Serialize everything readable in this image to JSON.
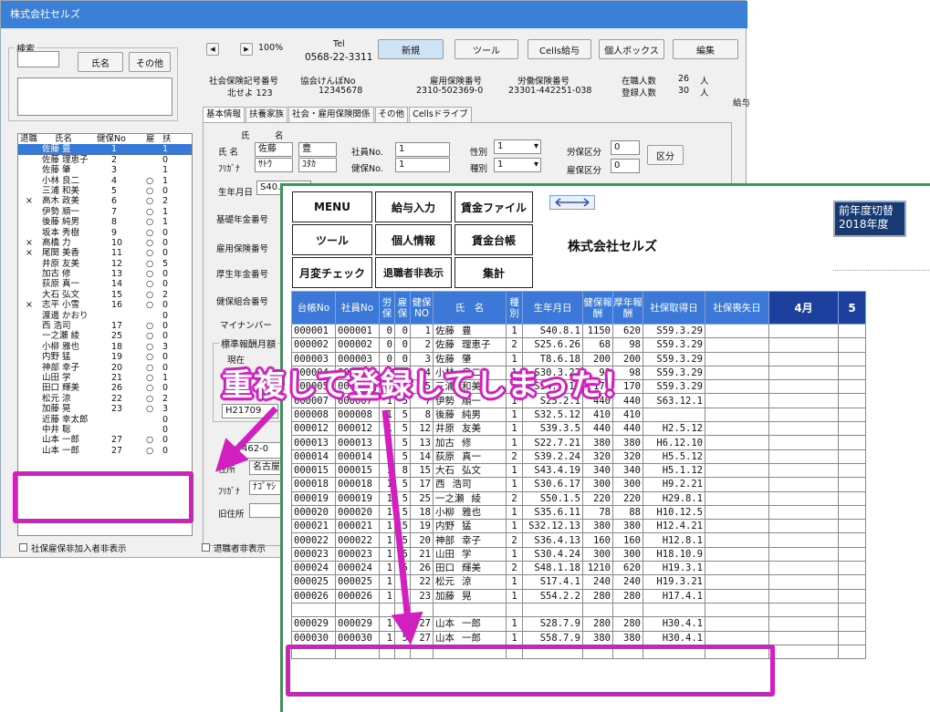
{
  "window": {
    "title": "株式会社セルズ"
  },
  "search": {
    "legend": "検索",
    "name_btn": "氏名",
    "other_btn": "その他"
  },
  "list_header": {
    "mark": "退職",
    "name": "氏名",
    "no": "健保No",
    "ken": "雇",
    "fu": "扶"
  },
  "employees": [
    {
      "mark": "",
      "name": "佐藤 豊",
      "no": "1",
      "ken": "",
      "fu": "1",
      "selected": true
    },
    {
      "mark": "",
      "name": "佐藤 理恵子",
      "no": "2",
      "ken": "",
      "fu": "0"
    },
    {
      "mark": "",
      "name": "佐藤 肇",
      "no": "3",
      "ken": "",
      "fu": "1"
    },
    {
      "mark": "",
      "name": "小林 良二",
      "no": "4",
      "ken": "○",
      "fu": "1"
    },
    {
      "mark": "",
      "name": "三浦 和美",
      "no": "5",
      "ken": "○",
      "fu": "0"
    },
    {
      "mark": "×",
      "name": "高木 政美",
      "no": "6",
      "ken": "○",
      "fu": "2"
    },
    {
      "mark": "",
      "name": "伊勢 順一",
      "no": "7",
      "ken": "○",
      "fu": "1"
    },
    {
      "mark": "",
      "name": "後藤 純男",
      "no": "8",
      "ken": "○",
      "fu": "1"
    },
    {
      "mark": "",
      "name": "坂本 秀樹",
      "no": "9",
      "ken": "○",
      "fu": "0"
    },
    {
      "mark": "×",
      "name": "高橋 力",
      "no": "10",
      "ken": "○",
      "fu": "0"
    },
    {
      "mark": "×",
      "name": "尾関 美香",
      "no": "11",
      "ken": "○",
      "fu": "0"
    },
    {
      "mark": "",
      "name": "井原 友美",
      "no": "12",
      "ken": "○",
      "fu": "5"
    },
    {
      "mark": "",
      "name": "加古 修",
      "no": "13",
      "ken": "○",
      "fu": "0"
    },
    {
      "mark": "",
      "name": "荻原 真一",
      "no": "14",
      "ken": "○",
      "fu": "0"
    },
    {
      "mark": "",
      "name": "大石 弘文",
      "no": "15",
      "ken": "○",
      "fu": "2"
    },
    {
      "mark": "×",
      "name": "志平 小雪",
      "no": "16",
      "ken": "○",
      "fu": "0"
    },
    {
      "mark": "",
      "name": "渡邊 かおり",
      "no": "",
      "ken": "",
      "fu": "0"
    },
    {
      "mark": "",
      "name": "西 浩司",
      "no": "17",
      "ken": "○",
      "fu": "0"
    },
    {
      "mark": "",
      "name": "一之瀬 綾",
      "no": "25",
      "ken": "○",
      "fu": "0"
    },
    {
      "mark": "",
      "name": "小柳 雅也",
      "no": "18",
      "ken": "○",
      "fu": "3"
    },
    {
      "mark": "",
      "name": "内野 猛",
      "no": "19",
      "ken": "○",
      "fu": "0"
    },
    {
      "mark": "",
      "name": "神部 幸子",
      "no": "20",
      "ken": "○",
      "fu": "0"
    },
    {
      "mark": "",
      "name": "山田 学",
      "no": "21",
      "ken": "○",
      "fu": "1"
    },
    {
      "mark": "",
      "name": "田口 輝美",
      "no": "26",
      "ken": "○",
      "fu": "0"
    },
    {
      "mark": "",
      "name": "松元 涼",
      "no": "22",
      "ken": "○",
      "fu": "2"
    },
    {
      "mark": "",
      "name": "加藤 晃",
      "no": "23",
      "ken": "○",
      "fu": "3"
    },
    {
      "mark": "",
      "name": "近藤 幸太郎",
      "no": "",
      "ken": "",
      "fu": "0"
    },
    {
      "mark": "",
      "name": "中井 聡",
      "no": "",
      "ken": "",
      "fu": "0"
    },
    {
      "mark": "",
      "name": "山本 一郎",
      "no": "27",
      "ken": "○",
      "fu": "0"
    },
    {
      "mark": "",
      "name": "山本 一郎",
      "no": "27",
      "ken": "○",
      "fu": "0"
    }
  ],
  "nav": {
    "first": "◀",
    "next": "▶",
    "zoom": "100%"
  },
  "tel": {
    "label": "Tel",
    "value": "0568-22-3311"
  },
  "toolbar": {
    "new": "新規",
    "tool": "ツール",
    "cells": "Cells給与",
    "personal": "個人ボックス",
    "edit": "編集"
  },
  "insurance": {
    "shaho_label": "社会保険記号番号",
    "shaho_value": "北せよ 123",
    "kyokai_label": "協会けんぽNo",
    "kyokai_value": "12345678",
    "koyo_label": "雇用保険番号",
    "koyo_value": "2310-502369-0",
    "rodo_label": "労働保険番号",
    "rodo_value": "23301-442251-038",
    "zaishoku_label": "在職人数",
    "zaishoku_value": "26",
    "toroku_label": "登録人数",
    "toroku_value": "30",
    "unit": "人",
    "kyu_label": "給与"
  },
  "tabs": [
    "基本情報",
    "扶養家族",
    "社会・雇用保険関係",
    "その他",
    "Cellsドライブ"
  ],
  "form": {
    "uji": "氏",
    "mei": "名",
    "name_label": "氏 名",
    "name_last": "佐藤",
    "name_first": "豊",
    "kana_label": "ﾌﾘｶﾞﾅ",
    "kana_last": "ｻﾄｳ",
    "kana_first": "ﾕﾀｶ",
    "shain_label": "社員No.",
    "shain_value": "1",
    "kenpo_label": "健保No.",
    "kenpo_value": "1",
    "seibetsu_label": "性別",
    "seibetsu_value": "1",
    "shubetsu_label": "種別",
    "shubetsu_value": "1",
    "rohoken_label": "労保区分",
    "rohoken_value": "0",
    "koho_label": "雇保区分",
    "koho_value": "0",
    "kubun_btn": "区分",
    "birth_label": "生年月日",
    "birth_value": "S40.8.1",
    "kiso_label": "基礎年金番号",
    "koyohoken_label": "雇用保険番号",
    "kosei_label": "厚生年金番号",
    "kenpokumiai_label": "健保組合番号",
    "mynumber_label": "マイナンバー",
    "hyojun_label": "標準報酬月額",
    "genzai_label": "現在",
    "genzai_value": "H21709",
    "zip_value": "462-0",
    "addr_label": "住所",
    "addr_value": "名古屋",
    "furigana_label": "ﾌﾘｶﾞﾅ",
    "furigana_value": "ﾅｺﾞﾔｼ",
    "kyujusho_label": "旧住所"
  },
  "footer": {
    "left_check": "社保雇保非加入者非表示",
    "right_check": "退職者非表示"
  },
  "front": {
    "menu": "MENU",
    "kyuyo": "給与入力",
    "chingin_file": "賃金ファイル",
    "tool": "ツール",
    "kojin": "個人情報",
    "chingin_daicho": "賃金台帳",
    "getsuhen": "月変チェック",
    "hihyoji": "退職者非表示",
    "shukei": "集計",
    "company": "株式会社セルズ",
    "switch_btn_line1": "前年度切替",
    "switch_btn_line2": "2018年度",
    "headers": [
      "台帳No",
      "社員No",
      "労保",
      "雇保",
      "健保NO",
      "氏　名",
      "種別",
      "生年月日",
      "健保報酬",
      "厚年報酬",
      "社保取得日",
      "社保喪失日",
      "4月",
      "5"
    ],
    "rows": [
      [
        "000001",
        "000001",
        "0",
        "0",
        "1",
        "佐藤",
        "豊",
        "1",
        "S40.8.1",
        "1150",
        "620",
        "S59.3.29"
      ],
      [
        "000002",
        "000002",
        "0",
        "0",
        "2",
        "佐藤",
        "理恵子",
        "2",
        "S25.6.26",
        "68",
        "98",
        "S59.3.29"
      ],
      [
        "000003",
        "000003",
        "0",
        "0",
        "3",
        "佐藤",
        "肇",
        "1",
        "T8.6.18",
        "200",
        "200",
        "S59.3.29"
      ],
      [
        "000004",
        "000004",
        "1",
        "5",
        "4",
        "小林",
        "良二",
        "1",
        "S30.3.22",
        "98",
        "98",
        "S59.3.29"
      ],
      [
        "000005",
        "000005",
        "1",
        "5",
        "5",
        "三浦",
        "和美",
        "2",
        "S34.5.15",
        "170",
        "170",
        "S59.3.29"
      ],
      [
        "000007",
        "000007",
        "1",
        "5",
        "7",
        "伊勢",
        "順一",
        "1",
        "S25.2.1",
        "440",
        "440",
        "S63.12.1"
      ],
      [
        "000008",
        "000008",
        "1",
        "5",
        "8",
        "後藤",
        "純男",
        "1",
        "S32.5.12",
        "410",
        "410",
        ""
      ],
      [
        "000012",
        "000012",
        "1",
        "5",
        "12",
        "井原",
        "友美",
        "1",
        "S39.3.5",
        "440",
        "440",
        "H2.5.12"
      ],
      [
        "000013",
        "000013",
        "1",
        "5",
        "13",
        "加古",
        "修",
        "1",
        "S22.7.21",
        "380",
        "380",
        "H6.12.10"
      ],
      [
        "000014",
        "000014",
        "1",
        "5",
        "14",
        "荻原",
        "真一",
        "2",
        "S39.2.24",
        "320",
        "320",
        "H5.5.12"
      ],
      [
        "000015",
        "000015",
        "1",
        "8",
        "15",
        "大石",
        "弘文",
        "1",
        "S43.4.19",
        "340",
        "340",
        "H5.1.12"
      ],
      [
        "000018",
        "000018",
        "1",
        "5",
        "17",
        "西",
        "浩司",
        "1",
        "S30.6.17",
        "300",
        "300",
        "H9.2.21"
      ],
      [
        "000019",
        "000019",
        "1",
        "5",
        "25",
        "一之瀬",
        "綾",
        "2",
        "S50.1.5",
        "220",
        "220",
        "H29.8.1"
      ],
      [
        "000020",
        "000020",
        "1",
        "5",
        "18",
        "小柳",
        "雅也",
        "1",
        "S35.6.11",
        "78",
        "88",
        "H10.12.5"
      ],
      [
        "000021",
        "000021",
        "1",
        "5",
        "19",
        "内野",
        "猛",
        "1",
        "S32.12.13",
        "380",
        "380",
        "H12.4.21"
      ],
      [
        "000022",
        "000022",
        "1",
        "5",
        "20",
        "神部",
        "幸子",
        "2",
        "S36.4.13",
        "160",
        "160",
        "H12.8.1"
      ],
      [
        "000023",
        "000023",
        "1",
        "5",
        "21",
        "山田",
        "学",
        "1",
        "S30.4.24",
        "300",
        "300",
        "H18.10.9"
      ],
      [
        "000024",
        "000024",
        "1",
        "5",
        "26",
        "田口",
        "輝美",
        "2",
        "S48.1.18",
        "1210",
        "620",
        "H19.3.1"
      ],
      [
        "000025",
        "000025",
        "1",
        "5",
        "22",
        "松元",
        "涼",
        "1",
        "S17.4.1",
        "240",
        "240",
        "H19.3.21"
      ],
      [
        "000026",
        "000026",
        "1",
        "5",
        "23",
        "加藤",
        "晃",
        "1",
        "S54.2.2",
        "280",
        "280",
        "H17.4.1"
      ],
      [
        "",
        "",
        "",
        "",
        "",
        "",
        "",
        "",
        "",
        "",
        "",
        ""
      ],
      [
        "000029",
        "000029",
        "1",
        "5",
        "27",
        "山本",
        "一郎",
        "1",
        "S28.7.9",
        "280",
        "280",
        "H30.4.1"
      ],
      [
        "000030",
        "000030",
        "1",
        "5",
        "27",
        "山本",
        "一郎",
        "1",
        "S58.7.9",
        "380",
        "380",
        "H30.4.1"
      ],
      [
        "",
        "",
        "",
        "",
        "",
        "",
        "",
        "",
        "",
        "",
        "",
        ""
      ]
    ]
  },
  "annotation": {
    "text": "重複して登録してしまった！",
    "color": "#d21fc0"
  },
  "colors": {
    "accent_blue": "#3b78d8",
    "highlight_magenta": "#d21fc0",
    "frame_green": "#1fa54b"
  }
}
